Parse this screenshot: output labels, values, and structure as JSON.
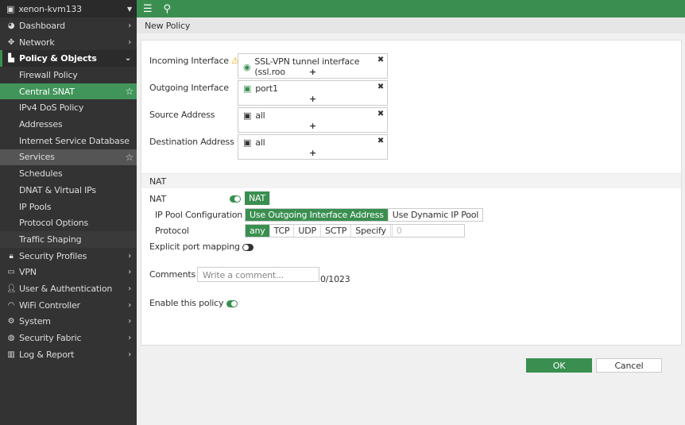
{
  "sidebar": {
    "device": "xenon-kvm133",
    "items": [
      {
        "label": "Dashboard",
        "icon": "dashboard-icon"
      },
      {
        "label": "Network",
        "icon": "network-icon"
      },
      {
        "label": "Policy & Objects",
        "icon": "policy-icon"
      },
      {
        "label": "Firewall Policy"
      },
      {
        "label": "Central SNAT"
      },
      {
        "label": "IPv4 DoS Policy"
      },
      {
        "label": "Addresses"
      },
      {
        "label": "Internet Service Database"
      },
      {
        "label": "Services"
      },
      {
        "label": "Schedules"
      },
      {
        "label": "DNAT & Virtual IPs"
      },
      {
        "label": "IP Pools"
      },
      {
        "label": "Protocol Options"
      },
      {
        "label": "Traffic Shaping"
      },
      {
        "label": "Security Profiles"
      },
      {
        "label": "VPN"
      },
      {
        "label": "User & Authentication"
      },
      {
        "label": "WiFi Controller"
      },
      {
        "label": "System"
      },
      {
        "label": "Security Fabric"
      },
      {
        "label": "Log & Report"
      }
    ]
  },
  "breadcrumb": "New Policy",
  "form": {
    "incoming": {
      "label": "Incoming Interface",
      "value": "SSL-VPN tunnel interface (ssl.roo"
    },
    "outgoing": {
      "label": "Outgoing Interface",
      "value": "port1"
    },
    "source": {
      "label": "Source Address",
      "value": "all"
    },
    "destination": {
      "label": "Destination Address",
      "value": "all"
    },
    "plus": "+",
    "remove": "✖",
    "nat_section": "NAT",
    "nat_label": "NAT",
    "nat_button": "NAT",
    "ip_pool_label": "IP Pool Configuration",
    "ip_pool_options": [
      "Use Outgoing Interface Address",
      "Use Dynamic IP Pool"
    ],
    "protocol_label": "Protocol",
    "protocol_options": [
      "any",
      "TCP",
      "UDP",
      "SCTP",
      "Specify"
    ],
    "protocol_number": "0",
    "explicit_port_label": "Explicit port mapping",
    "comments_label": "Comments",
    "comments_placeholder": "Write a comment...",
    "comments_count": "0/1023",
    "enable_label": "Enable this policy"
  },
  "buttons": {
    "ok": "OK",
    "cancel": "Cancel"
  },
  "colors": {
    "accent": "#3a8f50",
    "sidebar": "#333333"
  }
}
